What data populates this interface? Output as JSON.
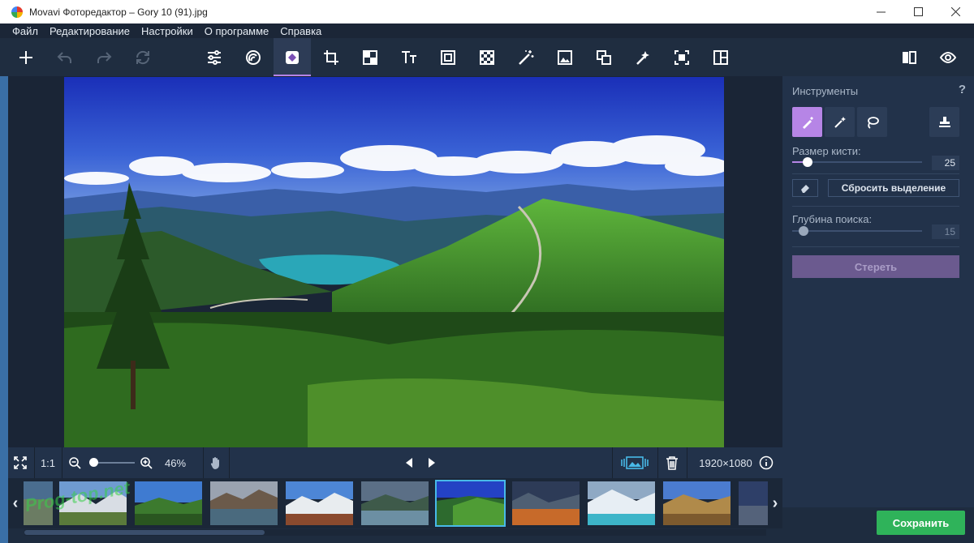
{
  "window": {
    "title": "Movavi Фоторедактор – Gory 10 (91).jpg"
  },
  "menu": [
    "Файл",
    "Редактирование",
    "Настройки",
    "О программе",
    "Справка"
  ],
  "toolbar": {
    "tools": [
      "add-icon",
      "undo-icon",
      "redo-icon",
      "reset-icon",
      "adjust-icon",
      "filters-icon",
      "object-removal-icon",
      "crop-icon",
      "retouch-icon",
      "text-icon",
      "frames-icon",
      "background-icon",
      "magic-enhance-icon",
      "insert-image-icon",
      "resize-icon",
      "highlight-icon",
      "selection-icon",
      "collage-icon",
      "compare-icon",
      "preview-icon"
    ],
    "active_tool": "object-removal-icon"
  },
  "panel": {
    "title": "Инструменты",
    "help": "?",
    "brush_size_label": "Размер кисти:",
    "brush_size_value": "25",
    "brush_size_fraction": 0.12,
    "reset_selection": "Сбросить выделение",
    "search_depth_label": "Глубина поиска:",
    "search_depth_value": "15",
    "erase_label": "Стереть"
  },
  "bottom": {
    "zoom_ratio": "1:1",
    "zoom_percent": "46%",
    "resolution": "1920×1080"
  },
  "save_label": "Сохранить",
  "watermark": "Prog-top.net",
  "colors": {
    "accent": "#b685e6",
    "save": "#2fb35a",
    "selected_thumb": "#48b9e8",
    "panel_bg": "#22324a"
  }
}
